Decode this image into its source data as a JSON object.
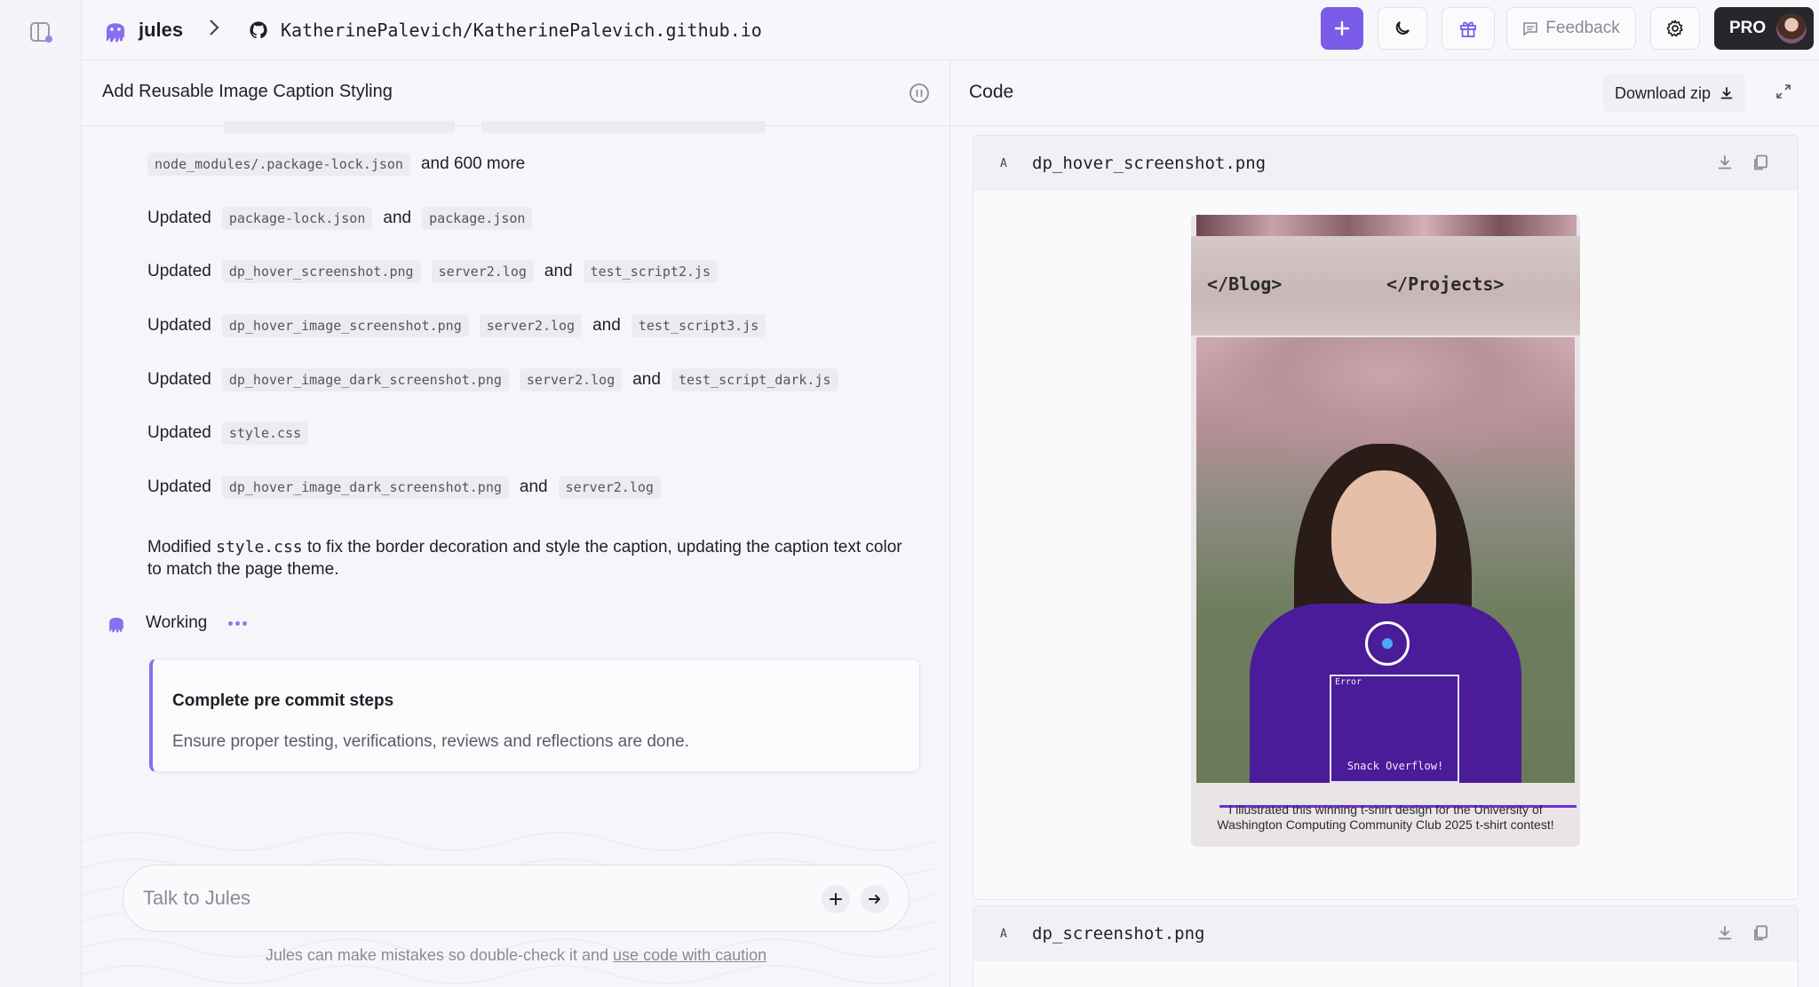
{
  "topbar": {
    "app_name": "jules",
    "repo": "KatherinePalevich/KatherinePalevich.github.io",
    "feedback_label": "Feedback",
    "pro_label": "PRO"
  },
  "task": {
    "title": "Add Reusable Image Caption Styling",
    "log": [
      {
        "parts": [
          {
            "chip": "node_modules/.package-lock.json"
          },
          {
            "text": "and 600 more"
          }
        ]
      },
      {
        "parts": [
          {
            "text": "Updated"
          },
          {
            "chip": "package-lock.json"
          },
          {
            "text": "and"
          },
          {
            "chip": "package.json"
          }
        ]
      },
      {
        "parts": [
          {
            "text": "Updated"
          },
          {
            "chip": "dp_hover_screenshot.png"
          },
          {
            "chip": "server2.log"
          },
          {
            "text": "and"
          },
          {
            "chip": "test_script2.js"
          }
        ]
      },
      {
        "parts": [
          {
            "text": "Updated"
          },
          {
            "chip": "dp_hover_image_screenshot.png"
          },
          {
            "chip": "server2.log"
          },
          {
            "text": "and"
          },
          {
            "chip": "test_script3.js"
          }
        ]
      },
      {
        "parts": [
          {
            "text": "Updated"
          },
          {
            "chip": "dp_hover_image_dark_screenshot.png"
          },
          {
            "chip": "server2.log"
          },
          {
            "text": "and"
          },
          {
            "chip": "test_script_dark.js"
          }
        ]
      },
      {
        "parts": [
          {
            "text": "Updated"
          },
          {
            "chip": "style.css"
          }
        ]
      },
      {
        "parts": [
          {
            "text": "Updated"
          },
          {
            "chip": "dp_hover_image_dark_screenshot.png"
          },
          {
            "text": "and"
          },
          {
            "chip": "server2.log"
          }
        ]
      }
    ],
    "modified_prefix": "Modified",
    "modified_code": "style.css",
    "modified_suffix": "to fix the border decoration and style the caption, updating the caption text color to match the page theme.",
    "status_label": "Working",
    "step": {
      "title": "Complete pre commit steps",
      "description": "Ensure proper testing, verifications, reviews and reflections are done."
    }
  },
  "chat": {
    "placeholder": "Talk to Jules",
    "disclaimer_text": "Jules can make mistakes so double-check it and",
    "disclaimer_link": "use code with caution"
  },
  "code_panel": {
    "title": "Code",
    "download_label": "Download zip",
    "files": [
      {
        "badge": "A",
        "name": "dp_hover_screenshot.png"
      },
      {
        "badge": "A",
        "name": "dp_screenshot.png"
      }
    ],
    "preview": {
      "nav_items": [
        "</Blog>",
        "</Projects>"
      ],
      "shirt_text": "Snack Overflow!",
      "shirt_error": "Error",
      "caption": "I illustrated this winning t-shirt design for the University of Washington Computing Community Club 2025 t-shirt contest!"
    }
  },
  "colors": {
    "accent": "#7a5bea",
    "pro_bg": "#26262b"
  }
}
